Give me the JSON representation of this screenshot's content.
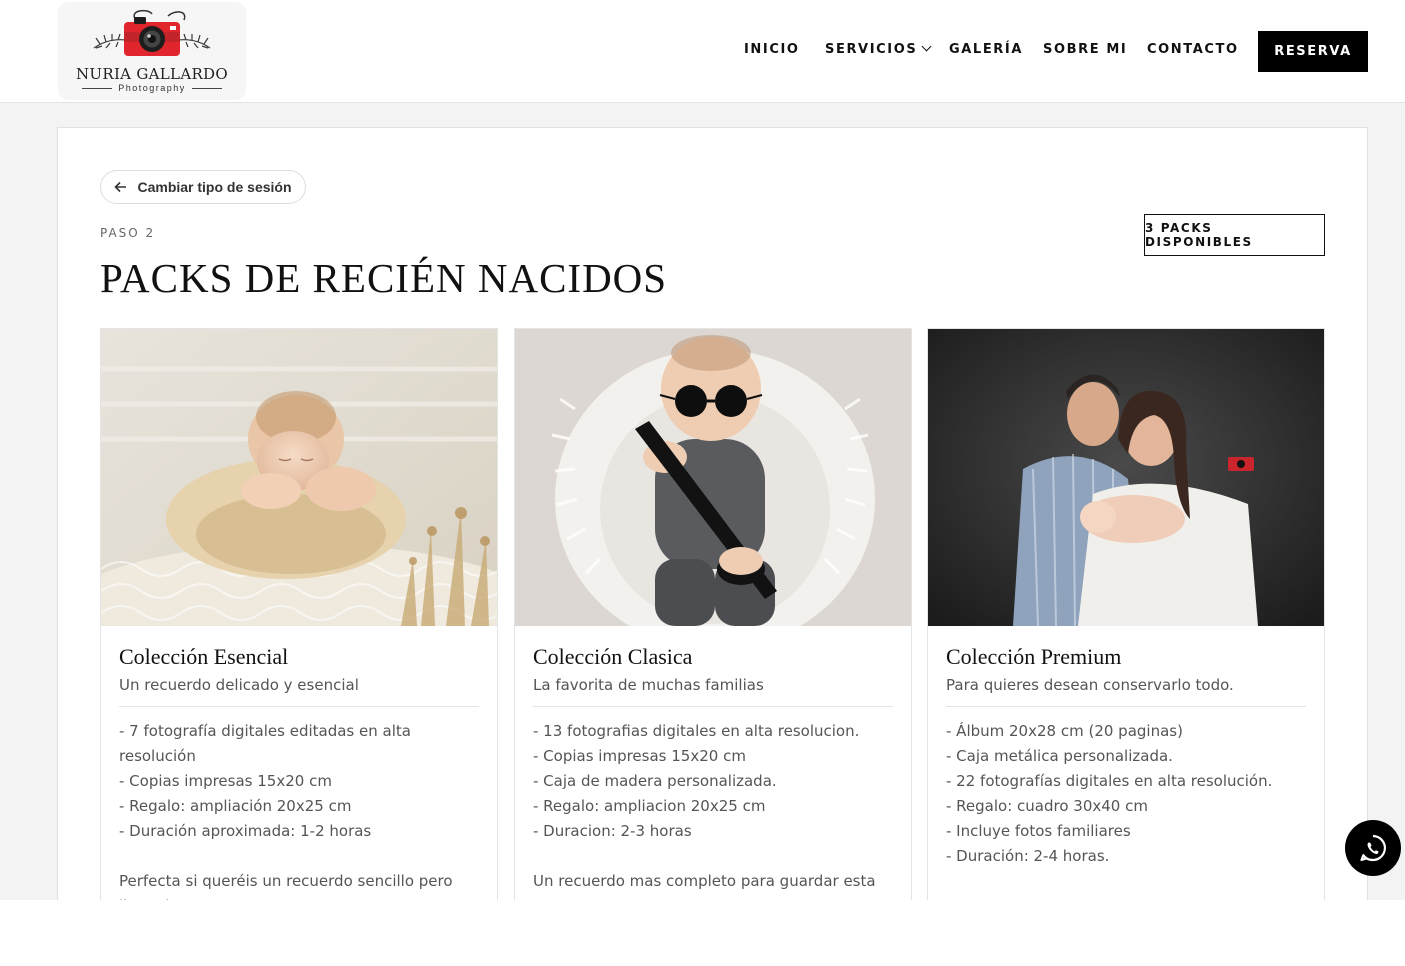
{
  "header": {
    "logo": {
      "brand": "NURIA GALLARDO",
      "subtitle": "Photography",
      "colors": {
        "camera_red": "#e0262c",
        "camera_dark": "#1d1d1d"
      }
    },
    "nav": [
      {
        "label": "INICIO"
      },
      {
        "label": "SERVICIOS",
        "has_dropdown": true
      },
      {
        "label": "GALERÍA"
      },
      {
        "label": "SOBRE MI"
      },
      {
        "label": "CONTACTO"
      }
    ],
    "cta_label": "RESERVA",
    "cta_color": "#000000"
  },
  "main": {
    "back_label": "Cambiar tipo de sesión",
    "step_label": "PASO 2",
    "title": "PACKS DE RECIÉN NACIDOS",
    "count_badge": "3 PACKS DISPONIBLES",
    "packs": [
      {
        "title": "Colección Esencial",
        "subtitle": "Un recuerdo delicado y esencial",
        "features": [
          "- 7 fotografía digitales editadas en alta resolución",
          "- Copias impresas 15x20 cm",
          "- Regalo: ampliación 20x25 cm",
          "- Duración aproximada: 1-2 horas"
        ],
        "note": "Perfecta si queréis un recuerdo sencillo pero lleno de ternura."
      },
      {
        "title": "Colección Clasica",
        "subtitle": "La favorita de muchas familias",
        "features": [
          "- 13 fotografias digitales en alta resolucion.",
          "- Copias impresas 15x20 cm",
          "- Caja de madera personalizada.",
          "- Regalo: ampliacion 20x25 cm",
          "- Duracion: 2-3 horas"
        ],
        "note": "Un recuerdo mas completo para guardar esta"
      },
      {
        "title": "Colección Premium",
        "subtitle": "Para quieres desean conservarlo todo.",
        "features": [
          "- Álbum 20x28 cm (20 paginas)",
          "- Caja metálica personalizada.",
          "- 22 fotografías digitales en alta resolución.",
          "- Regalo: cuadro 30x40 cm",
          "- Incluye fotos familiares",
          "- Duración: 2-4 horas."
        ],
        "note": ""
      }
    ]
  },
  "whatsapp": {
    "icon": "whatsapp-icon",
    "color": "#000000"
  }
}
